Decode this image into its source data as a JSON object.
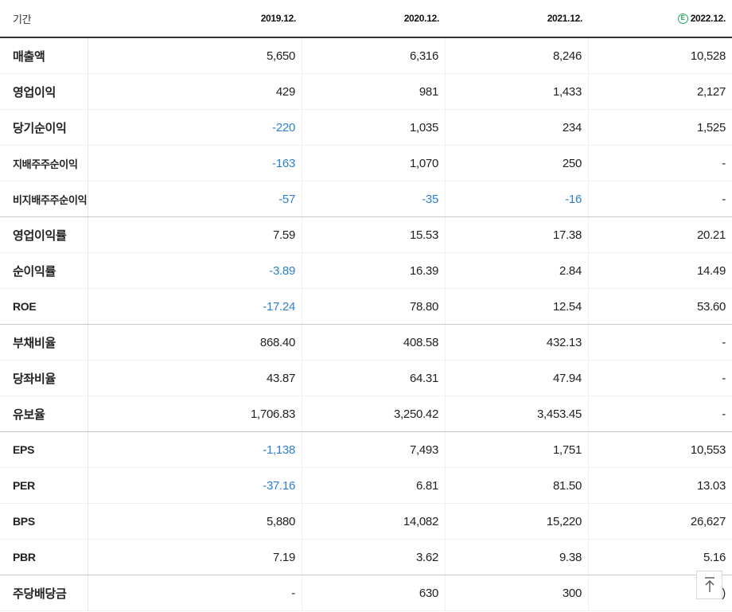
{
  "header": {
    "period_label": "기간",
    "columns": [
      "2019.12.",
      "2020.12.",
      "2021.12.",
      "2022.12."
    ],
    "estimate_badge": "E"
  },
  "rows": [
    {
      "label": "매출액",
      "values": [
        "5,650",
        "6,316",
        "8,246",
        "10,528"
      ]
    },
    {
      "label": "영업이익",
      "values": [
        "429",
        "981",
        "1,433",
        "2,127"
      ]
    },
    {
      "label": "당기순이익",
      "values": [
        "-220",
        "1,035",
        "234",
        "1,525"
      ]
    },
    {
      "label": "지배주주순이익",
      "values": [
        "-163",
        "1,070",
        "250",
        "-"
      ]
    },
    {
      "label": "비지배주주순이익",
      "values": [
        "-57",
        "-35",
        "-16",
        "-"
      ]
    },
    {
      "label": "영업이익률",
      "values": [
        "7.59",
        "15.53",
        "17.38",
        "20.21"
      ]
    },
    {
      "label": "순이익률",
      "values": [
        "-3.89",
        "16.39",
        "2.84",
        "14.49"
      ]
    },
    {
      "label": "ROE",
      "values": [
        "-17.24",
        "78.80",
        "12.54",
        "53.60"
      ]
    },
    {
      "label": "부채비율",
      "values": [
        "868.40",
        "408.58",
        "432.13",
        "-"
      ]
    },
    {
      "label": "당좌비율",
      "values": [
        "43.87",
        "64.31",
        "47.94",
        "-"
      ]
    },
    {
      "label": "유보율",
      "values": [
        "1,706.83",
        "3,250.42",
        "3,453.45",
        "-"
      ]
    },
    {
      "label": "EPS",
      "values": [
        "-1,138",
        "7,493",
        "1,751",
        "10,553"
      ]
    },
    {
      "label": "PER",
      "values": [
        "-37.16",
        "6.81",
        "81.50",
        "13.03"
      ]
    },
    {
      "label": "BPS",
      "values": [
        "5,880",
        "14,082",
        "15,220",
        "26,627"
      ]
    },
    {
      "label": "PBR",
      "values": [
        "7.19",
        "3.62",
        "9.38",
        "5.16"
      ]
    },
    {
      "label": "주당배당금",
      "values": [
        "-",
        "630",
        "300",
        ")"
      ]
    }
  ],
  "colors": {
    "negative": "#2d7fd8",
    "estimate_badge": "#1fa65a"
  },
  "scroll_top_icon": "arrow-up-to-top-icon"
}
